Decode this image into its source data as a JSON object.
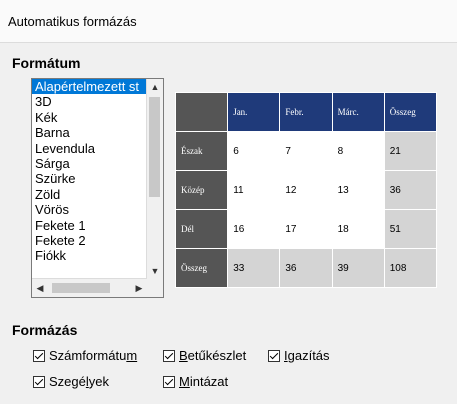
{
  "window": {
    "title": "Automatikus formázás"
  },
  "sections": {
    "format": "Formátum",
    "formatting": "Formázás"
  },
  "list": {
    "items": [
      "Alapértelmezett st",
      "3D",
      "Kék",
      "Barna",
      "Levendula",
      "Sárga",
      "Szürke",
      "Zöld",
      "Vörös",
      "Fekete 1",
      "Fekete 2",
      "Fiókk"
    ],
    "selected_index": 0
  },
  "preview": {
    "headers": [
      "Jan.",
      "Febr.",
      "Márc.",
      "Összeg"
    ],
    "rows": [
      {
        "label": "Észak",
        "values": [
          "6",
          "7",
          "8",
          "21"
        ]
      },
      {
        "label": "Közép",
        "values": [
          "11",
          "12",
          "13",
          "36"
        ]
      },
      {
        "label": "Dél",
        "values": [
          "16",
          "17",
          "18",
          "51"
        ]
      },
      {
        "label": "Összeg",
        "values": [
          "33",
          "36",
          "39",
          "108"
        ]
      }
    ],
    "colors": {
      "header": "#1f3a7a",
      "row_header": "#555555",
      "total": "#d4d4d4"
    }
  },
  "options": {
    "number_format": {
      "pre": "Számformátu",
      "u": "m",
      "post": "",
      "checked": true
    },
    "font": {
      "pre": "",
      "u": "B",
      "post": "etűkészlet",
      "checked": true
    },
    "alignment": {
      "pre": "",
      "u": "I",
      "post": "gazítás",
      "checked": true
    },
    "borders": {
      "pre": "Szegé",
      "u": "l",
      "post": "yek",
      "checked": true
    },
    "pattern": {
      "pre": "",
      "u": "M",
      "post": "intázat",
      "checked": true
    }
  }
}
